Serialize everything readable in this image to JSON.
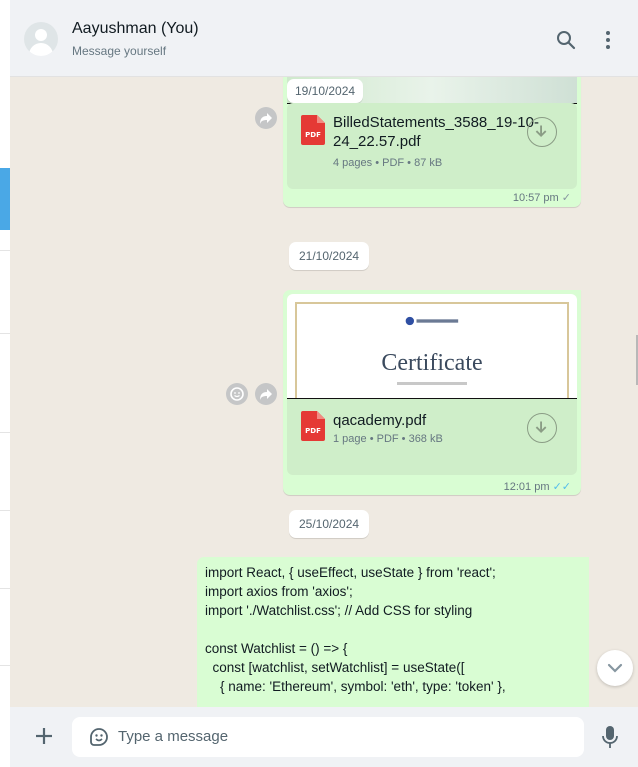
{
  "header": {
    "title": "Aayushman (You)",
    "subtitle": "Message yourself",
    "search_icon": "search-icon",
    "menu_icon": "kebab-menu-icon"
  },
  "messages": {
    "doc1": {
      "date_header": "19/10/2024",
      "file_name_line1": "BilledStatements_3588_19-10-",
      "file_name_line2": "24_22.57.pdf",
      "meta": "4 pages • PDF • 87 kB",
      "time": "10:57 pm",
      "tick": "✓"
    },
    "date_chip_2": "21/10/2024",
    "doc2": {
      "thumbnail_title": "Certificate",
      "file_name": "qacademy.pdf",
      "meta": "1 page • PDF • 368 kB",
      "time": "12:01 pm",
      "tick": "✓✓"
    },
    "date_chip_3": "25/10/2024",
    "code_lines": [
      "import React, { useEffect, useState } from 'react';",
      "import axios from 'axios';",
      "import './Watchlist.css'; // Add CSS for styling",
      "",
      "const Watchlist = () => {",
      "  const [watchlist, setWatchlist] = useState([",
      "    { name: 'Ethereum', symbol: 'eth', type: 'token' },"
    ]
  },
  "composer": {
    "placeholder": "Type a message",
    "plus_icon": "plus-icon",
    "sticker_icon": "sticker-icon",
    "mic_icon": "mic-icon"
  },
  "colors": {
    "outgoing_bubble": "#d9fdd3",
    "chat_background": "#efeae2",
    "read_tick": "#53bdeb",
    "pdf_red": "#e53935"
  }
}
